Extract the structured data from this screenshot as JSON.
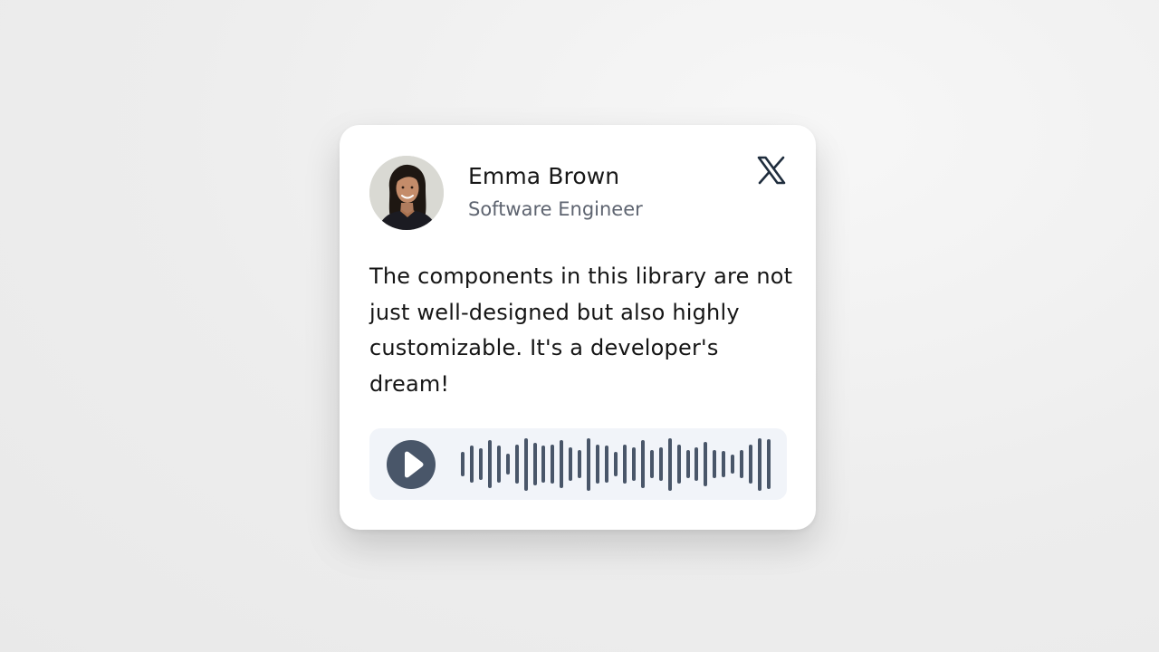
{
  "profile": {
    "name": "Emma Brown",
    "role": "Software Engineer",
    "avatar_icon": "person-photo-icon"
  },
  "brand": {
    "icon": "x-logo-icon",
    "color": "#1f2d3d"
  },
  "testimonial": {
    "text": "The components in this library are not just well-designed but also highly customizable. It's a developer's dream!"
  },
  "audio": {
    "play_icon": "play-icon",
    "accent_color": "#495669",
    "background_color": "#f1f4f9",
    "waveform_levels": [
      0.45,
      0.7,
      0.6,
      0.9,
      0.7,
      0.4,
      0.75,
      1.0,
      0.8,
      0.7,
      0.75,
      0.9,
      0.65,
      0.55,
      1.0,
      0.75,
      0.7,
      0.45,
      0.75,
      0.65,
      0.9,
      0.55,
      0.65,
      1.0,
      0.75,
      0.55,
      0.65,
      0.85,
      0.55,
      0.5,
      0.35,
      0.55,
      0.75,
      1.0,
      0.95
    ]
  }
}
